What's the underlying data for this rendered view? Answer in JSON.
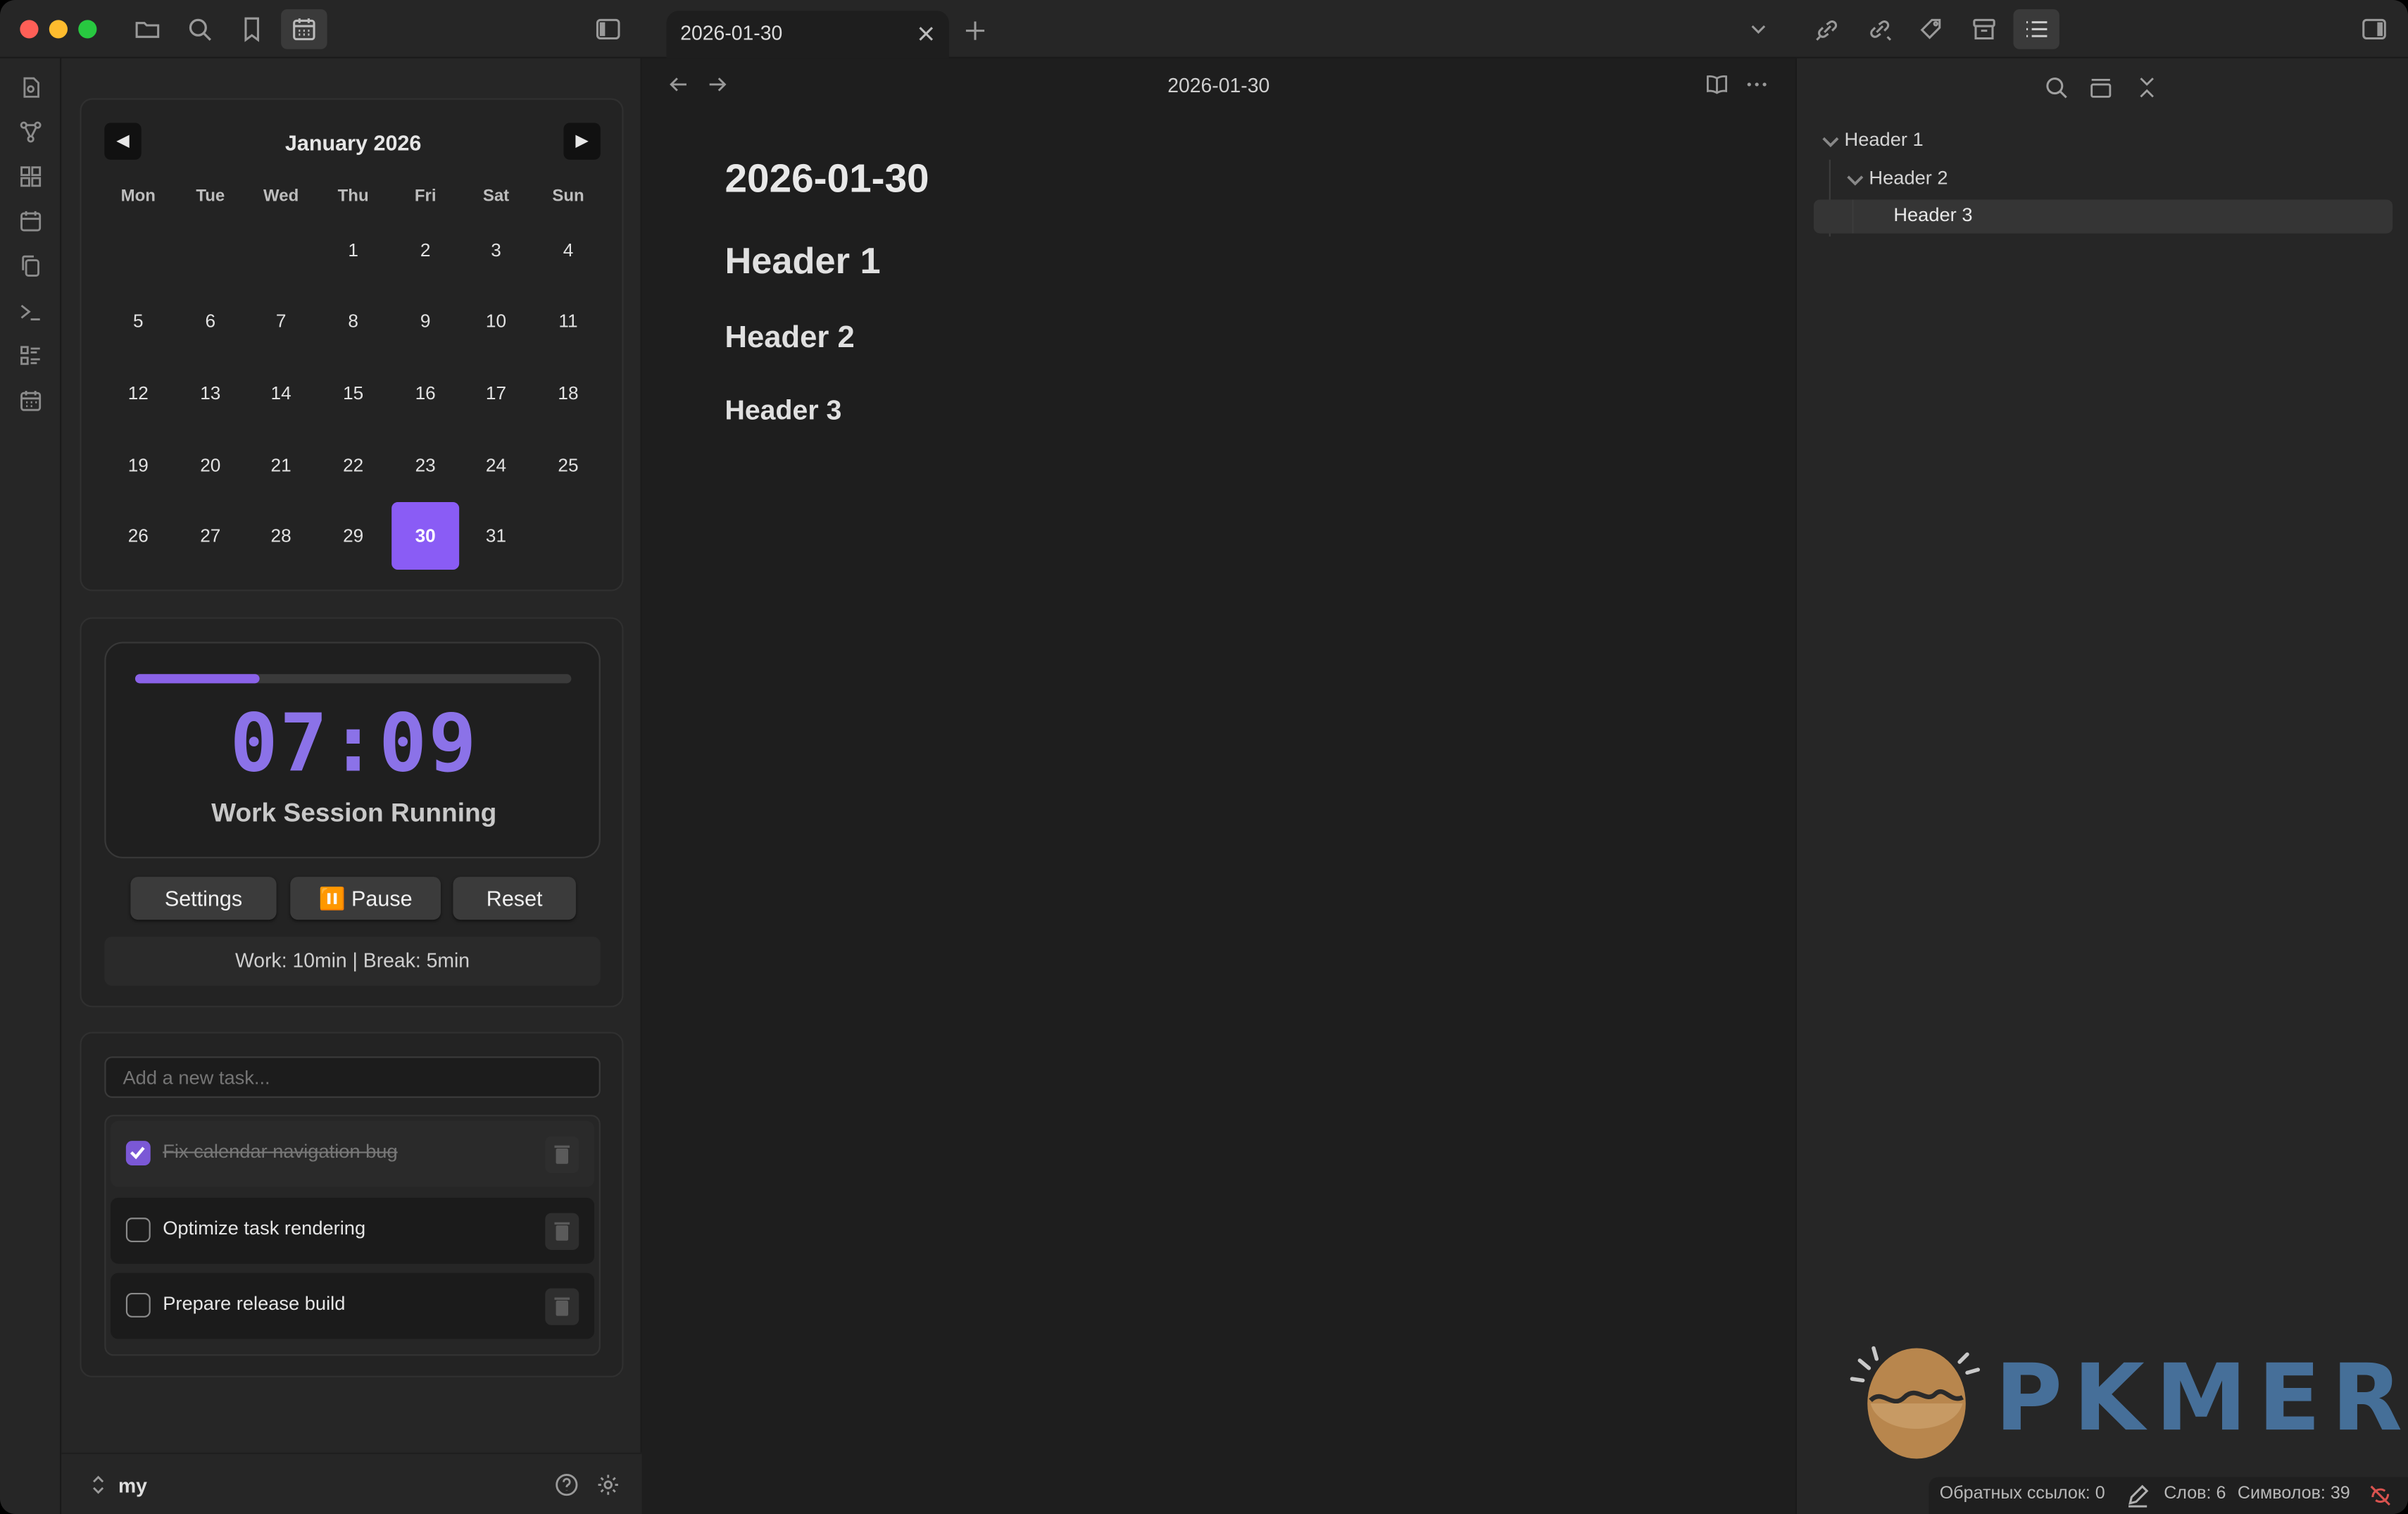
{
  "window": {
    "traffic_lights": {
      "close": "#ff5f57",
      "minimize": "#febc2e",
      "zoom": "#28c840"
    },
    "toolbar_icons": [
      "folder-icon",
      "search-icon",
      "bookmark-icon",
      "calendar-icon"
    ],
    "right_toolbar_icons": [
      "chevron-down-icon",
      "backlink-icon",
      "outgoing-link-icon",
      "tag-icon",
      "archive-icon",
      "outline-icon",
      "right-sidebar-toggle-icon"
    ]
  },
  "tab": {
    "title": "2026-01-30"
  },
  "ribbon": {
    "icons": [
      "file-icon",
      "graph-icon",
      "dashboard-icon",
      "calendar-icon",
      "copy-icon",
      "terminal-icon",
      "task-list-icon",
      "calendar-grid-icon"
    ]
  },
  "calendar": {
    "title": "January 2026",
    "prev": "◀",
    "next": "▶",
    "weekdays": [
      "Mon",
      "Tue",
      "Wed",
      "Thu",
      "Fri",
      "Sat",
      "Sun"
    ],
    "first_weekday_index": 3,
    "days_in_month": 31,
    "today": 30,
    "accent": "#8a5cf5"
  },
  "timer": {
    "progress": 0.285,
    "time": "07:09",
    "status": "Work Session Running",
    "buttons": {
      "settings": "Settings",
      "pause": "⏸️ Pause",
      "reset": "Reset"
    },
    "info": "Work: 10min | Break: 5min",
    "accent": "#8b72e8"
  },
  "tasks": {
    "placeholder": "Add a new task...",
    "items": [
      {
        "text": "Fix calendar navigation bug",
        "done": true
      },
      {
        "text": "Optimize task rendering",
        "done": false
      },
      {
        "text": "Prepare release build",
        "done": false
      }
    ]
  },
  "vault": {
    "name": "my"
  },
  "editor": {
    "nav_title": "2026-01-30",
    "inline_title": "2026-01-30",
    "headings": [
      "Header 1",
      "Header 2",
      "Header 3"
    ]
  },
  "outline": {
    "items": [
      "Header 1",
      "Header 2",
      "Header 3"
    ]
  },
  "status_bar": {
    "backlinks": "Обратных ссылок: 0",
    "words": "Слов: 6",
    "chars": "Символов: 39"
  },
  "watermark": {
    "text": "PKMER"
  }
}
